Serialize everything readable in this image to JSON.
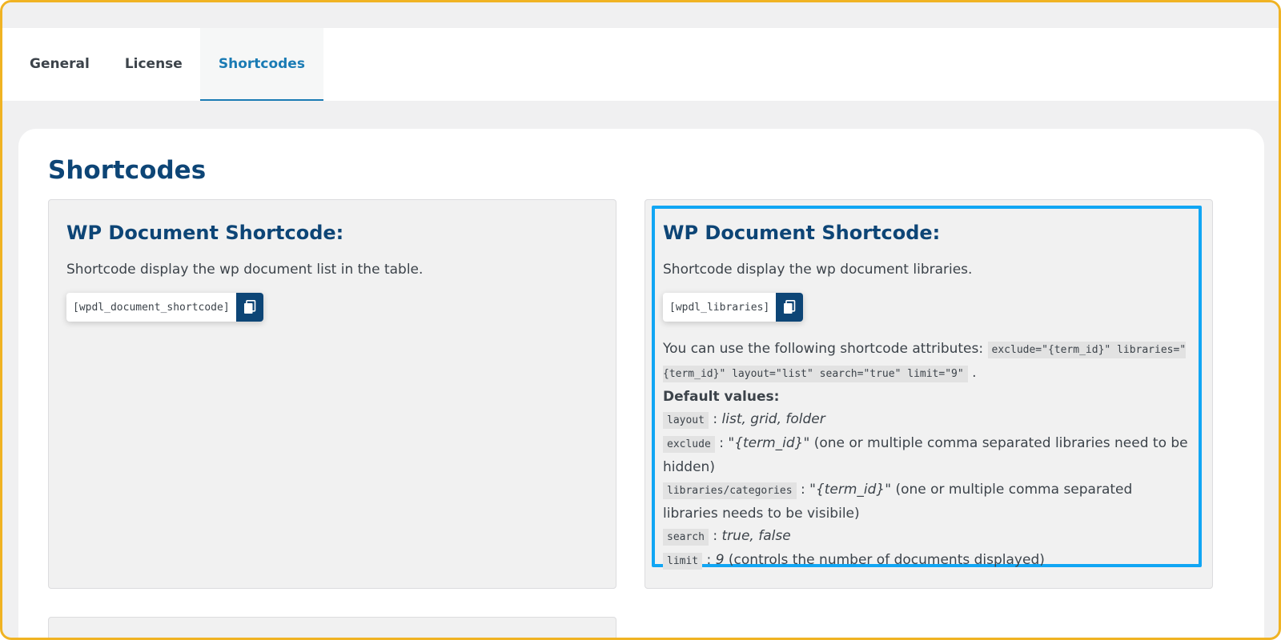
{
  "tabs": [
    "General",
    "License",
    "Shortcodes"
  ],
  "active_tab": "Shortcodes",
  "page_title": "Shortcodes",
  "cards": [
    {
      "title": "WP Document Shortcode:",
      "description": "Shortcode display the wp document list in the table.",
      "shortcode": "[wpdl_document_shortcode]"
    },
    {
      "title": "WP Document Shortcode:",
      "description": "Shortcode display the wp document libraries.",
      "shortcode": "[wpdl_libraries]",
      "attributes_intro": "You can use the following shortcode attributes:",
      "attributes_code": "exclude=\"{term_id}\" libraries=\"{term_id}\" layout=\"list\" search=\"true\" limit=\"9\"",
      "default_values_label": "Default values:",
      "defaults": [
        {
          "key": "layout",
          "value": "list, grid, folder",
          "note": ""
        },
        {
          "key": "exclude",
          "value": "\"{term_id}\"",
          "note": " (one or multiple comma separated libraries need to be hidden)"
        },
        {
          "key": "libraries/categories",
          "value": "\"{term_id}\"",
          "note": " (one or multiple comma separated libraries needs to be visibile)"
        },
        {
          "key": "search",
          "value": "true, false",
          "note": ""
        },
        {
          "key": "limit",
          "value": "9",
          "note": " (controls the number of documents displayed)"
        }
      ]
    }
  ],
  "icons": {
    "copy": "copy-icon"
  },
  "colors": {
    "frame_border": "#f0b323",
    "title": "#0d4576",
    "active_tab": "#1a7bb4",
    "highlight": "#11a6f4",
    "copy_button": "#0d4576"
  }
}
